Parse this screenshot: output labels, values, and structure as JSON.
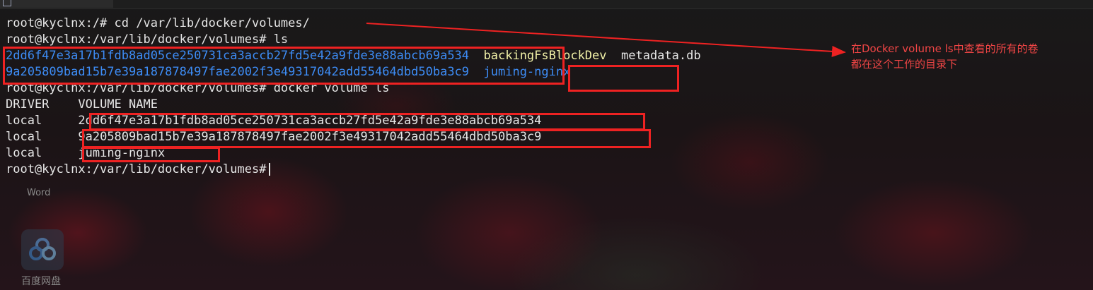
{
  "terminal": {
    "lines": {
      "l1": "root@kyclnx:/# cd /var/lib/docker/volumes/",
      "l2": "root@kyclnx:/var/lib/docker/volumes# ls",
      "l3_vol1": "2dd6f47e3a17b1fdb8ad05ce250731ca3accb27fd5e42a9fde3e88abcb69a534",
      "l3_backing": "backingFsBlockDev",
      "l3_meta": "metadata.db",
      "l4_vol2": "9a205809bad15b7e39a187878497fae2002f3e49317042add55464dbd50ba3c9",
      "l4_juming": "juming-nginx",
      "l5": "root@kyclnx:/var/lib/docker/volumes# docker volume ls",
      "l6_driver": "DRIVER",
      "l6_name": "VOLUME NAME",
      "rows": [
        {
          "driver": "local",
          "name": "2dd6f47e3a17b1fdb8ad05ce250731ca3accb27fd5e42a9fde3e88abcb69a534"
        },
        {
          "driver": "local",
          "name": "9a205809bad15b7e39a187878497fae2002f3e49317042add55464dbd50ba3c9"
        },
        {
          "driver": "local",
          "name": "juming-nginx"
        }
      ],
      "prompt": "root@kyclnx:/var/lib/docker/volumes#"
    }
  },
  "annotation": {
    "line1": "在Docker volume ls中查看的所有的卷",
    "line2": "都在这个工作的目录下"
  },
  "desktop": {
    "word_label": "Word",
    "baidu_label": "百度网盘"
  },
  "colors": {
    "highlight": "#ee2222",
    "directory_blue": "#3d8cf5",
    "file_yellow": "#f2f2a8",
    "annotation_red": "#f04545"
  }
}
